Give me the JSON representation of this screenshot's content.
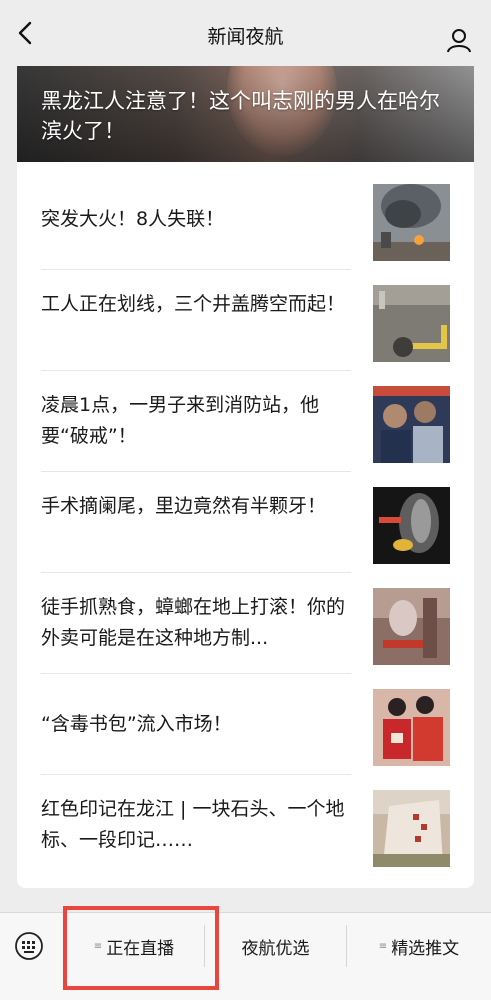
{
  "header": {
    "title": "新闻夜航",
    "back_icon": "chevron-left-icon",
    "profile_icon": "user-icon"
  },
  "hero": {
    "headline": "黑龙江人注意了！这个叫志刚的男人在哈尔滨火了！"
  },
  "articles": [
    {
      "title": "突发大火！8人失联！",
      "thumb": "fire-smoke-image"
    },
    {
      "title": "工人正在划线，三个井盖腾空而起！",
      "thumb": "manhole-road-image"
    },
    {
      "title": "凌晨1点，一男子来到消防站，他要“破戒”！",
      "thumb": "firefighters-image"
    },
    {
      "title": "手术摘阑尾，里边竟然有半颗牙！",
      "thumb": "xray-scan-image"
    },
    {
      "title": "徒手抓熟食，蟑螂在地上打滚！你的外卖可能是在这种地方制...",
      "thumb": "kitchen-image"
    },
    {
      "title": "“含毒书包”流入市场！",
      "thumb": "students-backpack-image"
    },
    {
      "title": "红色印记在龙江 | 一块石头、一个地标、一段印记……",
      "thumb": "stone-monument-image"
    }
  ],
  "bottom_menu": {
    "keyboard_icon": "keyboard-icon",
    "tabs": [
      {
        "label": "正在直播",
        "has_submenu": true
      },
      {
        "label": "夜航优选",
        "has_submenu": false
      },
      {
        "label": "精选推文",
        "has_submenu": true
      }
    ]
  },
  "colors": {
    "background": "#ededed",
    "card": "#ffffff",
    "highlight_box": "#e8463e"
  }
}
